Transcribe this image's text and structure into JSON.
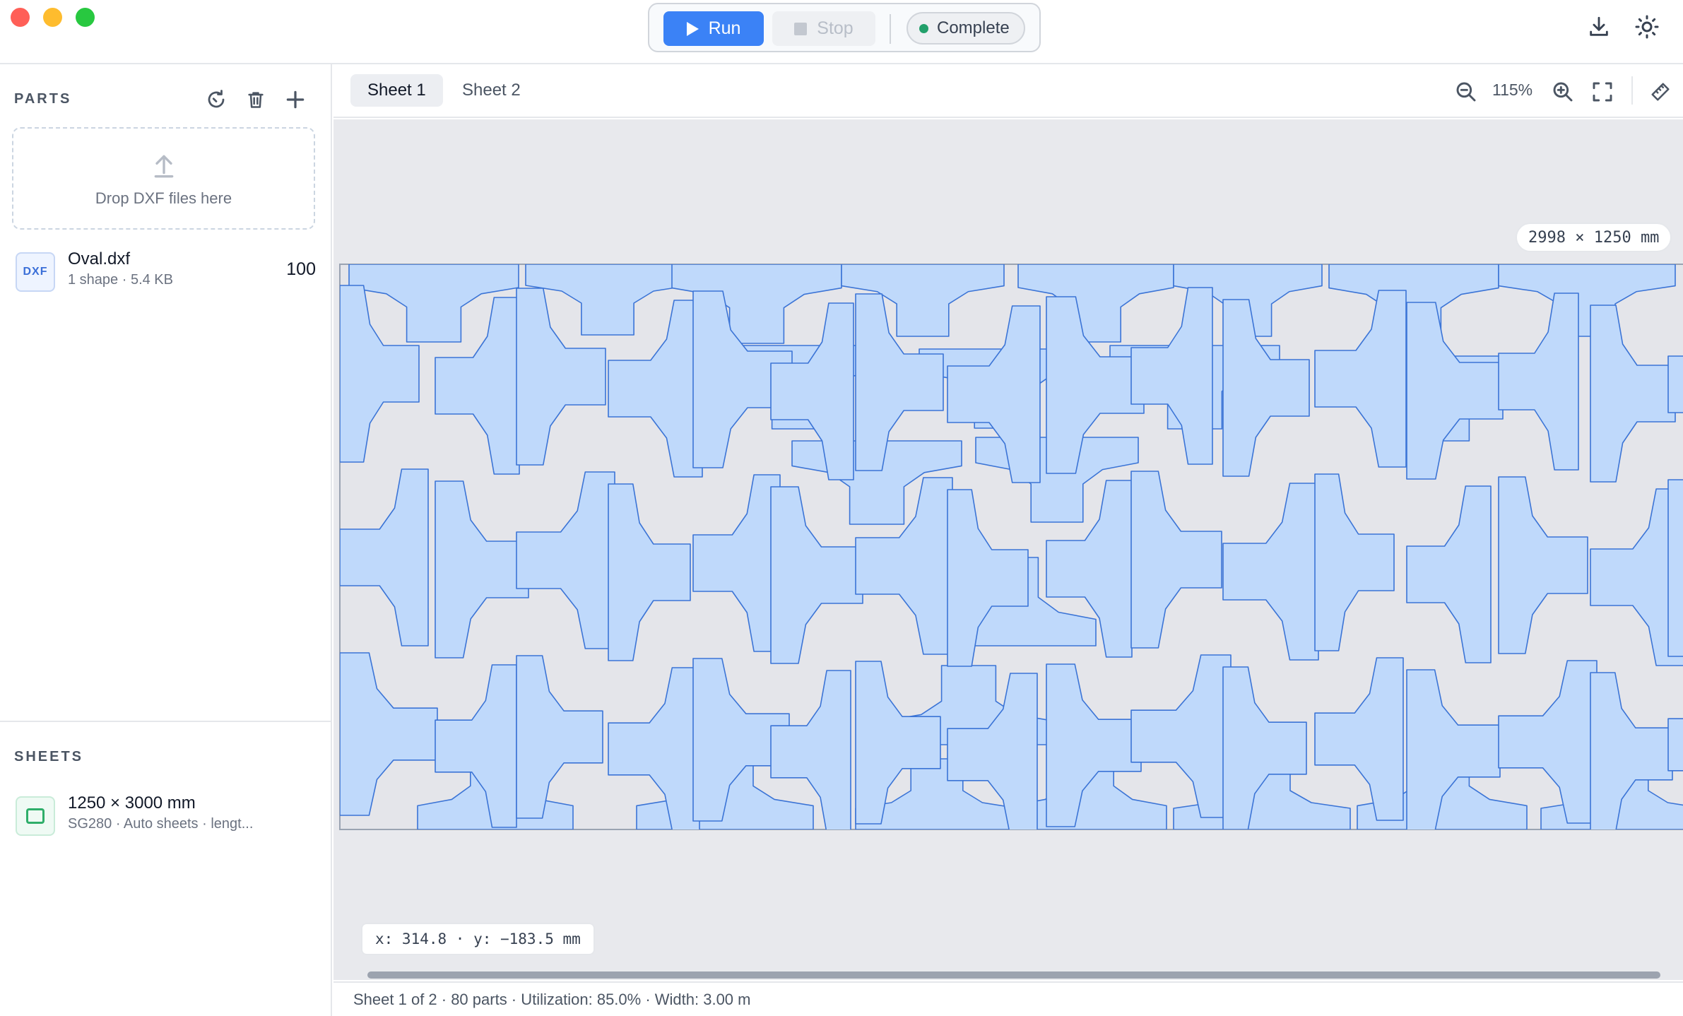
{
  "toolbar": {
    "run_label": "Run",
    "stop_label": "Stop",
    "status_label": "Complete",
    "status_color": "#22a06b",
    "accent_color": "#3b82f6",
    "icons": [
      "download-icon",
      "brightness-icon"
    ]
  },
  "sidebar": {
    "parts_title": "PARTS",
    "parts_tools": [
      "refresh-icon",
      "trash-icon",
      "plus-icon"
    ],
    "dropzone_label": "Drop DXF files here",
    "parts": [
      {
        "badge": "DXF",
        "name": "Oval.dxf",
        "meta": "1 shape · 5.4 KB",
        "qty": "100"
      }
    ],
    "sheets_title": "SHEETS",
    "sheets": [
      {
        "name": "1250 × 3000 mm",
        "meta": "SG280 · Auto sheets · lengt..."
      }
    ]
  },
  "tabs": [
    {
      "label": "Sheet 1",
      "active": true
    },
    {
      "label": "Sheet 2",
      "active": false
    }
  ],
  "view": {
    "zoom": "115%",
    "tools": [
      "zoom-out-icon",
      "zoom-in-icon",
      "fit-screen-icon",
      "ruler-icon"
    ]
  },
  "canvas": {
    "sheet_dimensions": "2998 × 1250 mm",
    "cursor_coords": "x: 314.8 · y: −183.5 mm",
    "part_fill": "#bfd9fb",
    "part_stroke": "#3b74d6",
    "sheet_bg": "#e8e9ed"
  },
  "status": {
    "text": "Sheet 1 of 2 · 80 parts · Utilization: 85.0% · Width: 3.00 m"
  }
}
